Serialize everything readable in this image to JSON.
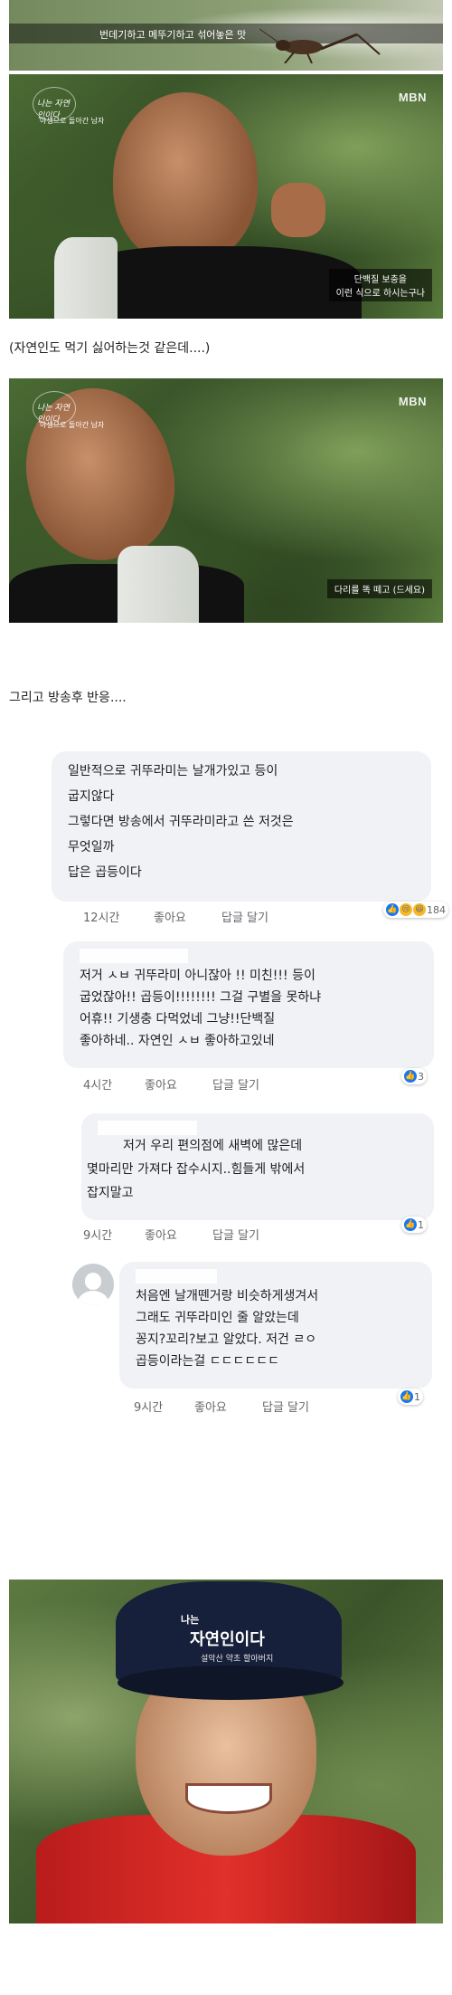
{
  "top_strip": {
    "caption": "번데기하고 메뚜기하고 섞어놓은 맛"
  },
  "still_1": {
    "channel": "MBN",
    "show_logo": "나는 자연인이다",
    "show_sub": "야생으로 돌아간 남자",
    "caption_line1": "단백질 보충을",
    "caption_line2": "이런 식으로 하시는구나"
  },
  "remark_1": "(자연인도 먹기 싫어하는것 같은데....)",
  "still_2": {
    "channel": "MBN",
    "show_logo": "나는 자연인이다",
    "show_sub": "야생으로 돌아간 남자",
    "caption": "다리를 똑 떼고 (드세요)"
  },
  "remark_2": "그리고 방송후 반응....",
  "comments": [
    {
      "lines": [
        "일반적으로 귀뚜라미는 날개가있고 등이",
        "굽지않다",
        "그렇다면 방송에서 귀뚜라미라고 쓴 저것은",
        "무엇일까",
        "답은 곱등이다"
      ],
      "time": "12시간",
      "like": "좋아요",
      "reply": "답글 달기",
      "reactions": "184"
    },
    {
      "lines": [
        "저거 ㅅㅂ 귀뚜라미 아니잖아 !! 미친!!! 등이",
        "굽었잖아!! 곱등이!!!!!!!! 그걸 구별을 못하냐",
        "어휴!! 기생충 다먹었네 그냥!!단백질",
        "좋아하네.. 자연인 ㅅㅂ 좋아하고있네"
      ],
      "time": "4시간",
      "like": "좋아요",
      "reply": "답글 달기",
      "reactions": "3"
    },
    {
      "lines": [
        "저거 우리 편의점에 새벽에 많은데",
        "몇마리만 가져다 잡수시지..힘들게 밖에서",
        "잡지말고"
      ],
      "time": "9시간",
      "like": "좋아요",
      "reply": "답글 달기",
      "reactions": "1"
    },
    {
      "lines": [
        "처음엔 날개뗀거랑 비슷하게생겨서",
        "그래도 귀뚜라미인 줄 알았는데",
        "꽁지?꼬리?보고 알았다. 저건 ㄹㅇ",
        "곱등이라는걸 ㄷㄷㄷㄷㄷㄷ"
      ],
      "time": "9시간",
      "like": "좋아요",
      "reply": "답글 달기",
      "reactions": "1"
    }
  ],
  "still_3": {
    "cap_line1": "나는",
    "cap_line2": "자연인이다",
    "cap_line3": "설악산 약초 할아버지"
  },
  "colors": {
    "like_blue": "#1877f2",
    "bubble_bg": "#f0f2f5",
    "meta_gray": "#65676b",
    "jacket_red": "#d8261f"
  },
  "icons": [
    "like-icon",
    "haha-icon",
    "sad-icon",
    "avatar-placeholder-icon"
  ]
}
